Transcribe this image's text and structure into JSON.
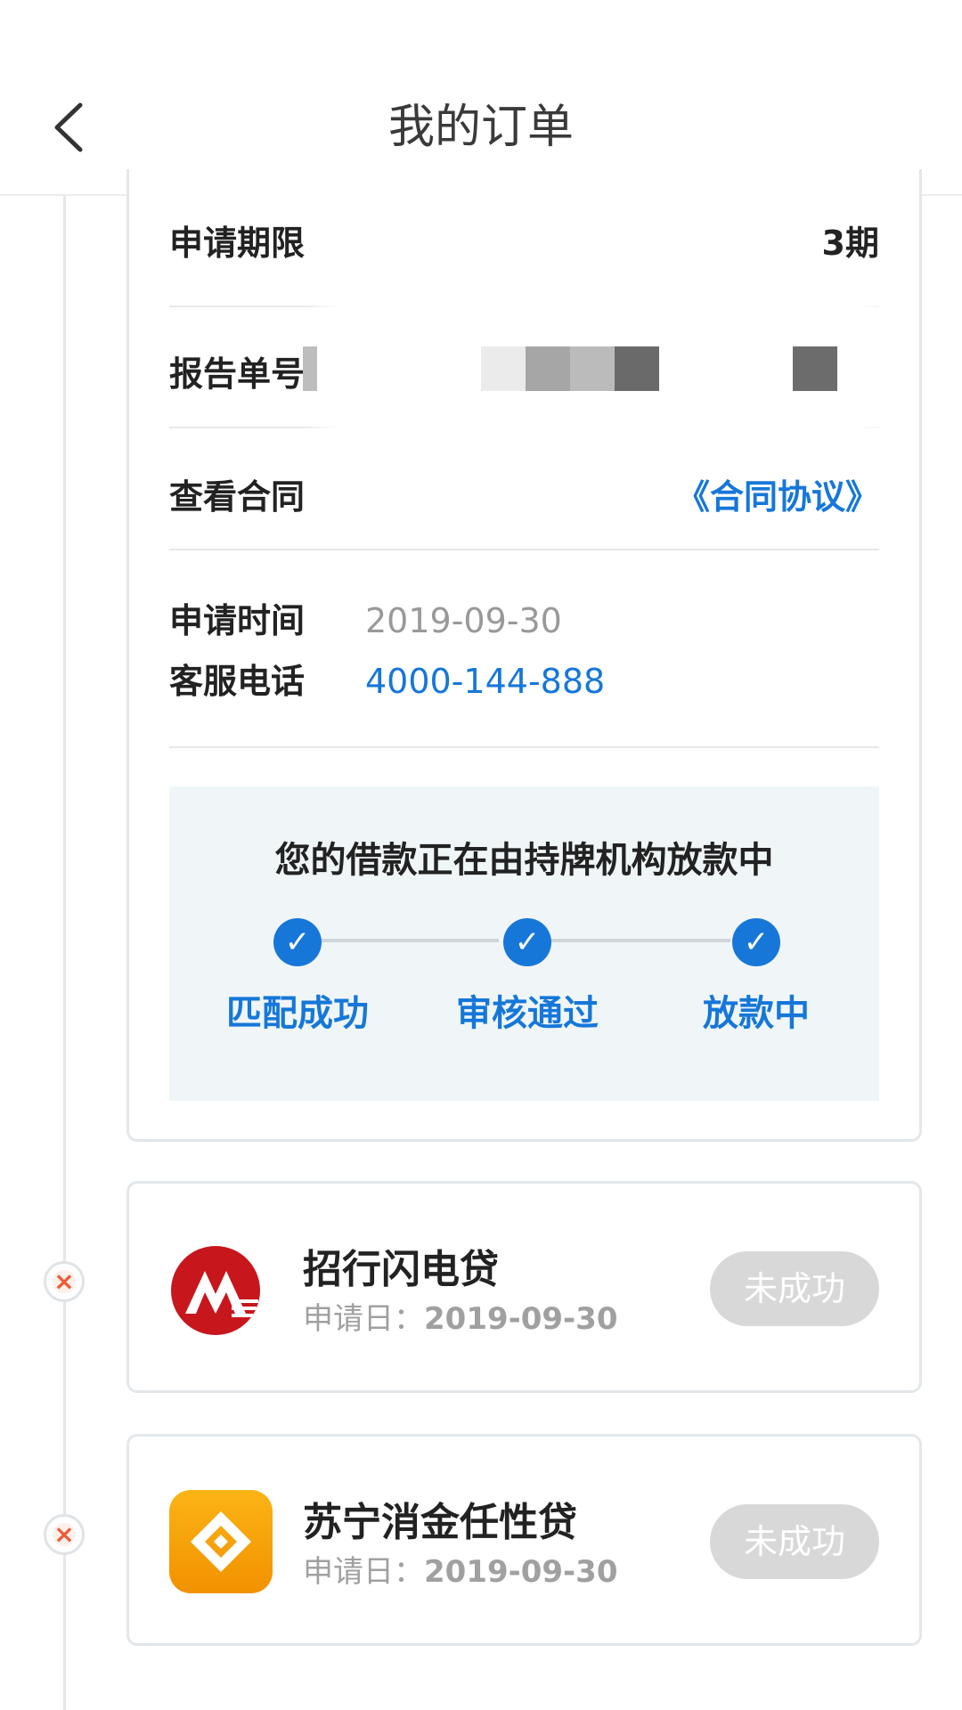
{
  "header": {
    "title": "我的订单",
    "back_icon": "chevron-left-icon"
  },
  "order": {
    "term_label": "申请期限",
    "term_value": "3期",
    "report_label": "报告单号",
    "contract_label": "查看合同",
    "contract_link": "《合同协议》",
    "apply_time_label": "申请时间",
    "apply_time_value": "2019-09-30",
    "service_phone_label": "客服电话",
    "service_phone_value": "4000-144-888",
    "progress": {
      "title": "您的借款正在由持牌机构放款中",
      "steps": [
        {
          "label": "匹配成功",
          "check": "✓"
        },
        {
          "label": "审核通过",
          "check": "✓"
        },
        {
          "label": "放款中",
          "check": "✓"
        }
      ]
    }
  },
  "orders": [
    {
      "name": "招行闪电贷",
      "date_label": "申请日：",
      "date_value": "2019-09-30",
      "status": "未成功",
      "icon": "cmb-bank-logo-icon",
      "mark": "×"
    },
    {
      "name": "苏宁消金任性贷",
      "date_label": "申请日：",
      "date_value": "2019-09-30",
      "status": "未成功",
      "icon": "suning-finance-logo-icon",
      "mark": "×"
    }
  ],
  "colors": {
    "accent": "#1677d9",
    "fail_mark": "#ef5a35",
    "pill_bg": "#d8d8d8",
    "progress_bg": "#f0f6f7"
  }
}
